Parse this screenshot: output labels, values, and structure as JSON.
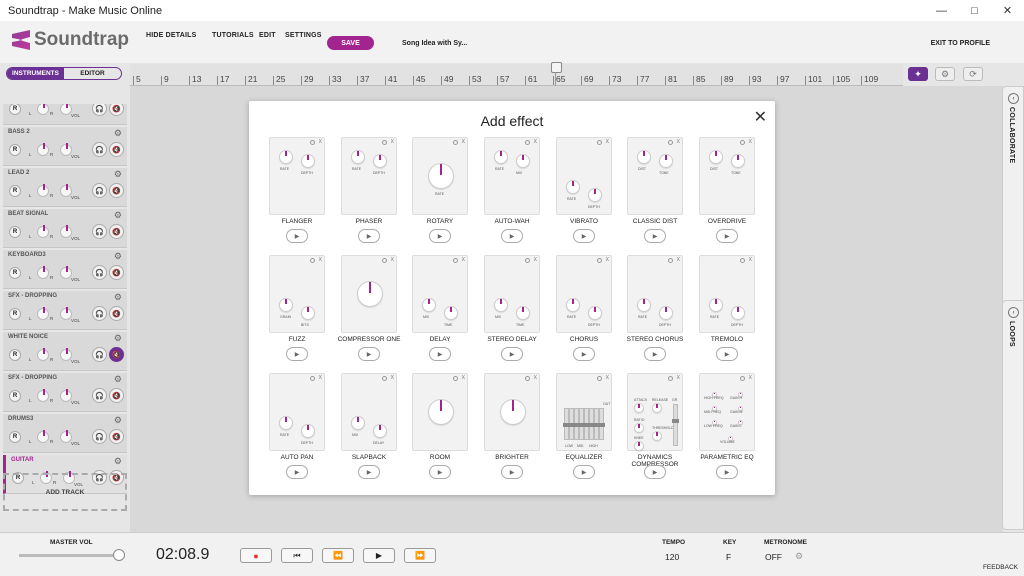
{
  "window": {
    "title": "Soundtrap - Make Music Online",
    "controls": [
      "—",
      "□",
      "✕"
    ]
  },
  "app": {
    "brand": "Soundtrap",
    "nav": [
      "HIDE DETAILS",
      "TUTORIALS",
      "EDIT",
      "SETTINGS"
    ],
    "save": "SAVE",
    "song": "Song Idea with Sy...",
    "exit": "EXIT TO PROFILE"
  },
  "tabs": {
    "instruments": "INSTRUMENTS",
    "editor": "EDITOR"
  },
  "ruler": {
    "ticks": [
      "5",
      "9",
      "13",
      "17",
      "21",
      "25",
      "29",
      "33",
      "37",
      "41",
      "45",
      "49",
      "53",
      "57",
      "61",
      "65",
      "69",
      "73",
      "77",
      "81",
      "85",
      "89",
      "93",
      "97",
      "101",
      "105",
      "109"
    ]
  },
  "tracks": [
    {
      "name": "",
      "muted": false
    },
    {
      "name": "BASS 2",
      "muted": false
    },
    {
      "name": "LEAD 2",
      "muted": false
    },
    {
      "name": "BEAT SIGNAL",
      "muted": false
    },
    {
      "name": "KEYBOARD3",
      "muted": false
    },
    {
      "name": "SFX - DROPPING",
      "muted": false
    },
    {
      "name": "WHITE NOICE",
      "muted": true
    },
    {
      "name": "SFX - DROPPING",
      "muted": false
    },
    {
      "name": "DRUMS3",
      "muted": false
    },
    {
      "name": "GUITAR",
      "muted": false,
      "selected": true
    }
  ],
  "track_labels": {
    "rec": "R",
    "left": "L",
    "right": "R",
    "vol": "VOL"
  },
  "add_track": "ADD TRACK",
  "side": {
    "collaborate": "COLLABORATE",
    "loops": "LOOPS"
  },
  "bottom": {
    "master_vol": "MASTER VOL",
    "time": "02:08.9",
    "tempo_label": "TEMPO",
    "tempo": "120",
    "key_label": "KEY",
    "key": "F",
    "metronome_label": "METRONOME",
    "metronome": "OFF",
    "feedback": "FEEDBACK"
  },
  "modal": {
    "title": "Add effect",
    "close": "✕"
  },
  "effects": [
    {
      "name": "FLANGER",
      "knobs": [
        "RATE",
        "DEPTH"
      ]
    },
    {
      "name": "PHASER",
      "knobs": [
        "RATE",
        "DEPTH"
      ]
    },
    {
      "name": "ROTARY",
      "knobs": [
        "RATE"
      ]
    },
    {
      "name": "AUTO-WAH",
      "knobs": [
        "RATE",
        "MIX"
      ]
    },
    {
      "name": "VIBRATO",
      "knobs": [
        "RATE",
        "DEPTH"
      ]
    },
    {
      "name": "CLASSIC DIST",
      "knobs": [
        "DIST",
        "TONE"
      ]
    },
    {
      "name": "OVERDRIVE",
      "knobs": [
        "DIST",
        "TONE"
      ]
    },
    {
      "name": "FUZZ",
      "knobs": [
        "GRAIN",
        "BITS"
      ]
    },
    {
      "name": "COMPRESSOR ONE",
      "knobs": []
    },
    {
      "name": "DELAY",
      "knobs": [
        "MIX",
        "TIME"
      ]
    },
    {
      "name": "STEREO DELAY",
      "knobs": [
        "MIX",
        "TIME"
      ]
    },
    {
      "name": "CHORUS",
      "knobs": [
        "RATE",
        "DEPTH"
      ]
    },
    {
      "name": "STEREO CHORUS",
      "knobs": [
        "RATE",
        "DEPTH"
      ]
    },
    {
      "name": "TREMOLO",
      "knobs": [
        "RATE",
        "DEPTH"
      ]
    },
    {
      "name": "AUTO PAN",
      "knobs": [
        "RATE",
        "DEPTH"
      ]
    },
    {
      "name": "SLAPBACK",
      "knobs": [
        "MIX",
        "DELAY"
      ]
    },
    {
      "name": "ROOM",
      "knobs": []
    },
    {
      "name": "BRIGHTER",
      "knobs": []
    },
    {
      "name": "EQUALIZER",
      "knobs": [
        "LOW",
        "MID",
        "HIGH",
        "OUT"
      ]
    },
    {
      "name": "DYNAMICS COMPRESSOR",
      "knobs": [
        "ATTACK",
        "RELEASE",
        "RATIO",
        "THRESHOLD",
        "KNEE",
        "GR"
      ]
    },
    {
      "name": "PARAMETRIC EQ",
      "knobs": [
        "HIGH FREQ",
        "GAIN H",
        "MID FREQ",
        "GAIN M",
        "LOW FREQ",
        "GAIN L",
        "VOLUME"
      ]
    }
  ],
  "colors": {
    "accent": "#a2248f",
    "purple": "#6a3093"
  }
}
